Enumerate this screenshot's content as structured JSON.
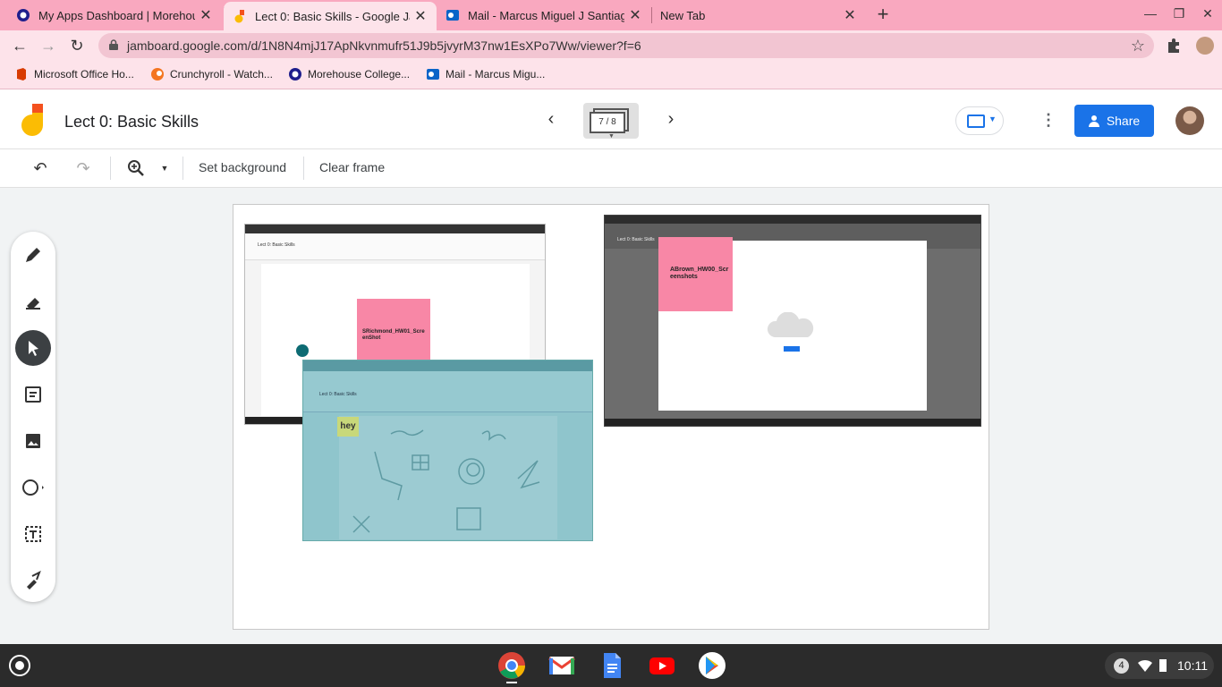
{
  "browser": {
    "tabs": [
      {
        "title": "My Apps Dashboard | Morehouse",
        "icon": "morehouse-logo-icon",
        "active": false
      },
      {
        "title": "Lect 0: Basic Skills - Google Jam",
        "icon": "jamboard-logo-icon",
        "active": true
      },
      {
        "title": "Mail - Marcus Miguel J Santiago",
        "icon": "outlook-logo-icon",
        "active": false
      },
      {
        "title": "New Tab",
        "icon": "",
        "active": false
      }
    ],
    "url": "jamboard.google.com/d/1N8N4mjJ17ApNkvnmufr51J9b5jvyrM37nw1EsXPo7Ww/viewer?f=6",
    "bookmarks": [
      {
        "label": "Microsoft Office Ho...",
        "icon": "office-logo-icon",
        "color": "#d83b01"
      },
      {
        "label": "Crunchyroll - Watch...",
        "icon": "crunchyroll-logo-icon",
        "color": "#f47521"
      },
      {
        "label": "Morehouse College...",
        "icon": "morehouse-logo-icon",
        "color": "#1e1e8c"
      },
      {
        "label": "Mail - Marcus Migu...",
        "icon": "outlook-logo-icon",
        "color": "#0a64c8"
      }
    ]
  },
  "jamboard": {
    "title": "Lect 0: Basic Skills",
    "frame_indicator": "7 / 8",
    "share_label": "Share",
    "toolbar": {
      "set_background": "Set background",
      "clear_frame": "Clear frame"
    },
    "tools": [
      "pen-icon",
      "eraser-icon",
      "select-icon",
      "sticky-note-icon",
      "image-icon",
      "circle-shape-icon",
      "text-box-icon",
      "laser-icon"
    ],
    "active_tool": "select-icon"
  },
  "canvas": {
    "shot1": {
      "note_text": "SRichmond_HW01_ScreenShot",
      "mini_title": "Lect 0: Basic Skills"
    },
    "shot2": {
      "note_text": "hey",
      "mini_title": "Lect 0: Basic Skills"
    },
    "shot3": {
      "note_text": "ABrown_HW00_Screenshots",
      "mini_title": "Lect 0: Basic Skills"
    }
  },
  "shelf": {
    "apps": [
      "chrome-icon",
      "gmail-icon",
      "docs-icon",
      "youtube-icon",
      "play-store-icon"
    ],
    "notification_count": "4",
    "time": "10:11"
  },
  "colors": {
    "tab_strip": "#f9a8bf",
    "accent": "#1a73e8",
    "sticky_pink": "#f887a6"
  }
}
